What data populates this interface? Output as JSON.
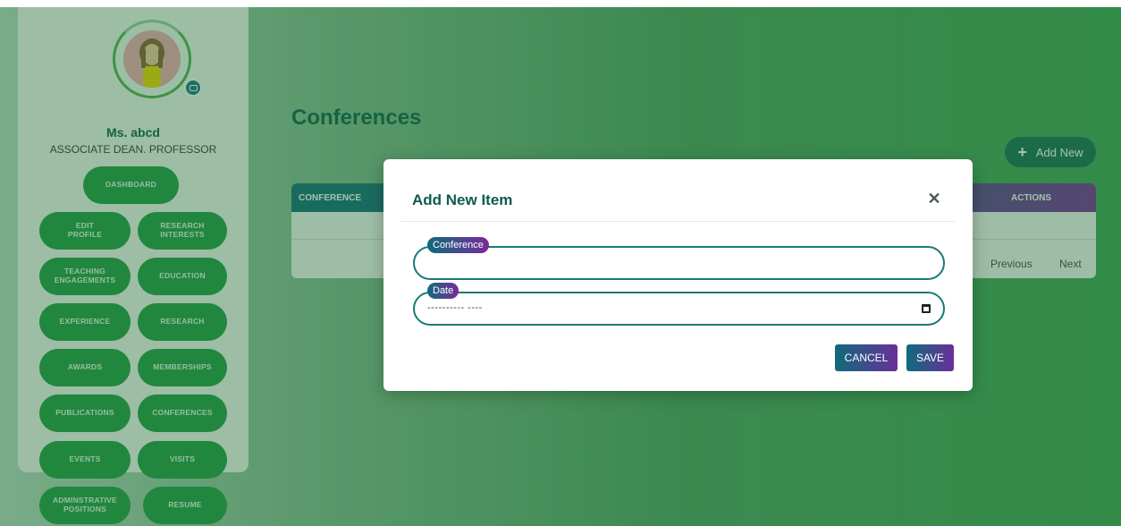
{
  "profile": {
    "name": "Ms. abcd",
    "role": "ASSOCIATE DEAN. PROFESSOR"
  },
  "sidebar": {
    "dashboard": "DASHBOARD",
    "items": [
      "EDIT\nPROFILE",
      "RESEARCH\nINTERESTS",
      "TEACHING\nENGAGEMENTS",
      "EDUCATION",
      "EXPERIENCE",
      "RESEARCH",
      "AWARDS",
      "MEMBERSHIPS",
      "PUBLICATIONS",
      "CONFERENCES",
      "EVENTS",
      "VISITS",
      "ADMINSTRATIVE\nPOSITIONS",
      "RESUME"
    ]
  },
  "main": {
    "title": "Conferences",
    "add_new_label": "Add New",
    "table": {
      "col_conference": "CONFERENCE",
      "col_actions": "ACTIONS"
    },
    "pager": {
      "previous": "Previous",
      "next": "Next"
    }
  },
  "modal": {
    "title": "Add New Item",
    "close_glyph": "✕",
    "conference_label": "Conference",
    "conference_value": "",
    "date_label": "Date",
    "date_placeholder": "---------- ----",
    "cancel_label": "CANCEL",
    "save_label": "SAVE"
  },
  "colors": {
    "accent_green": "#1f9a45",
    "title_teal": "#0d5b4f",
    "gradient_start": "#0f6b7a",
    "gradient_end": "#7a2a9a"
  }
}
